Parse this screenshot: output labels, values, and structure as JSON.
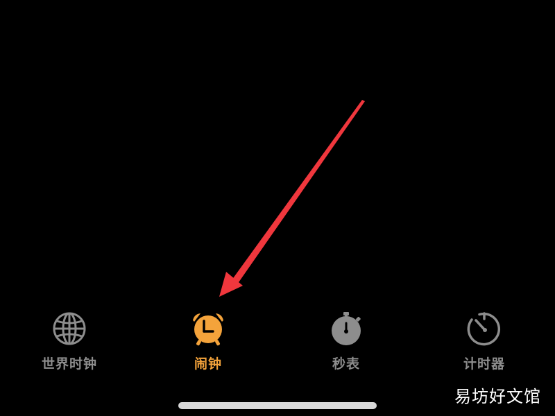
{
  "tab_bar": {
    "tabs": [
      {
        "label": "世界时钟",
        "icon": "globe-icon",
        "active": false
      },
      {
        "label": "闹钟",
        "icon": "alarm-clock-icon",
        "active": true
      },
      {
        "label": "秒表",
        "icon": "stopwatch-icon",
        "active": false
      },
      {
        "label": "计时器",
        "icon": "timer-icon",
        "active": false
      }
    ]
  },
  "colors": {
    "background": "#000000",
    "active": "#f4a33b",
    "inactive": "#8d8d8d",
    "annotation_arrow": "#f0373d"
  },
  "annotation": {
    "type": "arrow",
    "points_to": "alarm-tab"
  },
  "watermark": {
    "text": "易坊好文馆"
  }
}
